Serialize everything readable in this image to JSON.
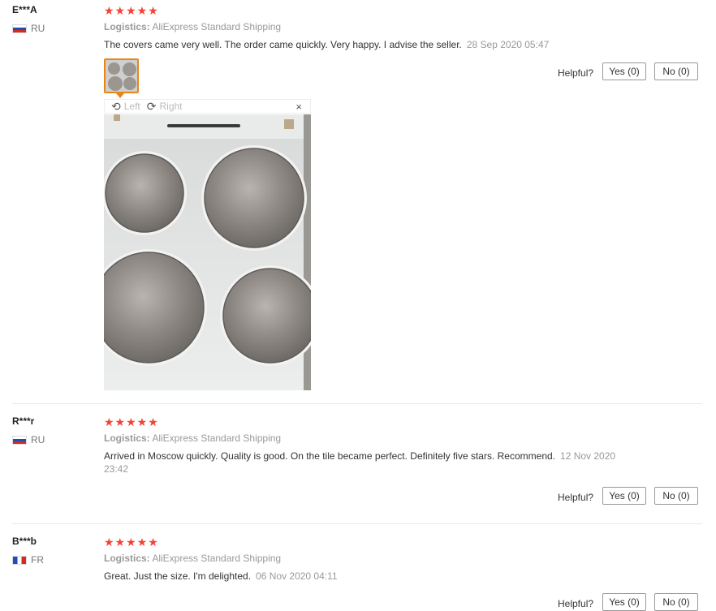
{
  "reviews": [
    {
      "name": "E***A",
      "country": "RU",
      "stars": "★★★★★",
      "logistics_label": "Logistics:",
      "logistics_value": "AliExpress Standard Shipping",
      "text": "The covers came very well. The order came quickly. Very happy. I advise the seller.",
      "date": "28 Sep 2020 05:47",
      "helpful_label": "Helpful?",
      "yes_label": "Yes (0)",
      "no_label": "No (0)",
      "viewer": {
        "left_label": "Left",
        "right_label": "Right",
        "close_label": "×"
      }
    },
    {
      "name": "R***r",
      "country": "RU",
      "stars": "★★★★★",
      "logistics_label": "Logistics:",
      "logistics_value": "AliExpress Standard Shipping",
      "text": "Arrived in Moscow quickly. Quality is good. On the tile became perfect. Definitely five stars. Recommend.",
      "date": "12 Nov 2020 23:42",
      "helpful_label": "Helpful?",
      "yes_label": "Yes (0)",
      "no_label": "No (0)"
    },
    {
      "name": "B***b",
      "country": "FR",
      "stars": "★★★★★",
      "logistics_label": "Logistics:",
      "logistics_value": "AliExpress Standard Shipping",
      "text": "Great. Just the size. I'm delighted.",
      "date": "06 Nov 2020 04:11",
      "helpful_label": "Helpful?",
      "yes_label": "Yes (0)",
      "no_label": "No (0)"
    }
  ],
  "colors": {
    "star": "#f44336",
    "thumb_border": "#e8861a",
    "muted": "#999999"
  },
  "icons": [
    "flag-ru-icon",
    "flag-fr-icon",
    "rotate-left-icon",
    "rotate-right-icon",
    "close-icon",
    "star-icon"
  ]
}
